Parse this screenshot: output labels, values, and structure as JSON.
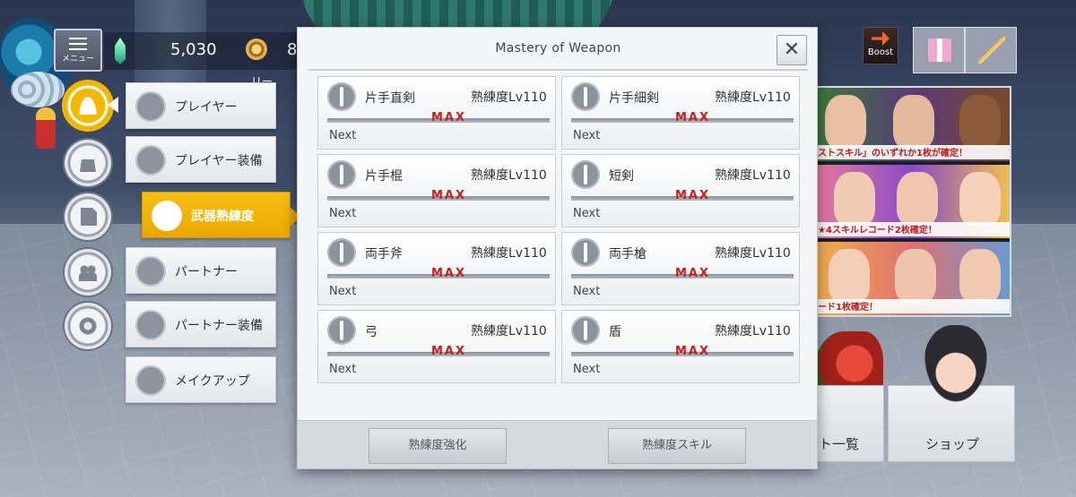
{
  "topbar": {
    "menu_label": "メニュー",
    "gem_count": "5,030",
    "coin_count": "8,",
    "partial_text": "リー",
    "boost_label": "Boost"
  },
  "nav": {
    "submenu": [
      {
        "label": "プレイヤー"
      },
      {
        "label": "プレイヤー装備"
      },
      {
        "label": "武器熟練度"
      },
      {
        "label": "パートナー"
      },
      {
        "label": "パートナー装備"
      },
      {
        "label": "メイクアップ"
      }
    ]
  },
  "banners": {
    "b1_caption": "ストスキル」のいずれか1枚が確定！",
    "b2_caption": "★4スキルレコード2枚確定！",
    "b3_caption": "ード1枚確定！"
  },
  "right_panels": {
    "list_label": "ト一覧",
    "shop_label": "ショップ"
  },
  "modal": {
    "title": "Mastery of Weapon",
    "close_symbol": "✕",
    "level_label": "熟練度Lv110",
    "max_label": "MAX",
    "next_label": "Next",
    "weapons": [
      {
        "name": "片手直剣",
        "progress": 1.0
      },
      {
        "name": "片手細剣",
        "progress": 1.0
      },
      {
        "name": "片手棍",
        "progress": 1.0
      },
      {
        "name": "短剣",
        "progress": 1.0
      },
      {
        "name": "両手斧",
        "progress": 1.0
      },
      {
        "name": "両手槍",
        "progress": 1.0
      },
      {
        "name": "弓",
        "progress": 1.0
      },
      {
        "name": "盾",
        "progress": 1.0
      }
    ],
    "buttons": {
      "enhance": "熟練度強化",
      "skill": "熟練度スキル"
    }
  }
}
